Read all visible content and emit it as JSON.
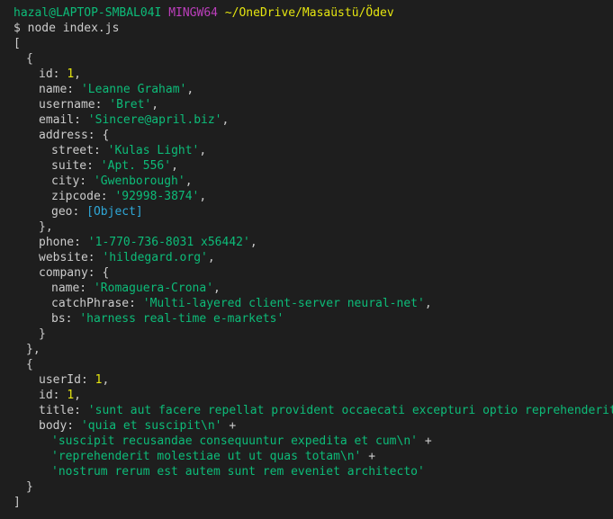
{
  "prompt": {
    "user_host": "hazal@LAPTOP-SMBAL04I",
    "system": "MINGW64",
    "path": "~/OneDrive/Masaüstü/Ödev"
  },
  "command": "$ node index.js",
  "output": {
    "array_open": "[",
    "array_close": "]",
    "user": {
      "id_key": "id: ",
      "id_val": "1",
      "name_key": "name: ",
      "name_val": "'Leanne Graham'",
      "username_key": "username: ",
      "username_val": "'Bret'",
      "email_key": "email: ",
      "email_val": "'Sincere@april.biz'",
      "address_key": "address: {",
      "street_key": "street: ",
      "street_val": "'Kulas Light'",
      "suite_key": "suite: ",
      "suite_val": "'Apt. 556'",
      "city_key": "city: ",
      "city_val": "'Gwenborough'",
      "zipcode_key": "zipcode: ",
      "zipcode_val": "'92998-3874'",
      "geo_key": "geo: ",
      "geo_val": "[Object]",
      "address_close": "},",
      "phone_key": "phone: ",
      "phone_val": "'1-770-736-8031 x56442'",
      "website_key": "website: ",
      "website_val": "'hildegard.org'",
      "company_key": "company: {",
      "company_name_key": "name: ",
      "company_name_val": "'Romaguera-Crona'",
      "catch_key": "catchPhrase: ",
      "catch_val": "'Multi-layered client-server neural-net'",
      "bs_key": "bs: ",
      "bs_val": "'harness real-time e-markets'",
      "company_close": "}"
    },
    "post": {
      "userId_key": "userId: ",
      "userId_val": "1",
      "id_key": "id: ",
      "id_val": "1",
      "title_key": "title: ",
      "title_val": "'sunt aut facere repellat provident occaecati excepturi optio reprehenderit'",
      "body_key": "body: ",
      "body_1": "'quia et suscipit\\n'",
      "body_2": "'suscipit recusandae consequuntur expedita et cum\\n'",
      "body_3": "'reprehenderit molestiae ut ut quas totam\\n'",
      "body_4": "'nostrum rerum est autem sunt rem eveniet architecto'",
      "plus": " +"
    },
    "obj_open": "{",
    "obj_close_comma": "},",
    "obj_close": "}"
  },
  "colors": {
    "background": "#1e1e1e",
    "string": "#0dbc79",
    "number": "#e5e510",
    "prompt_system": "#bc3fbc"
  }
}
